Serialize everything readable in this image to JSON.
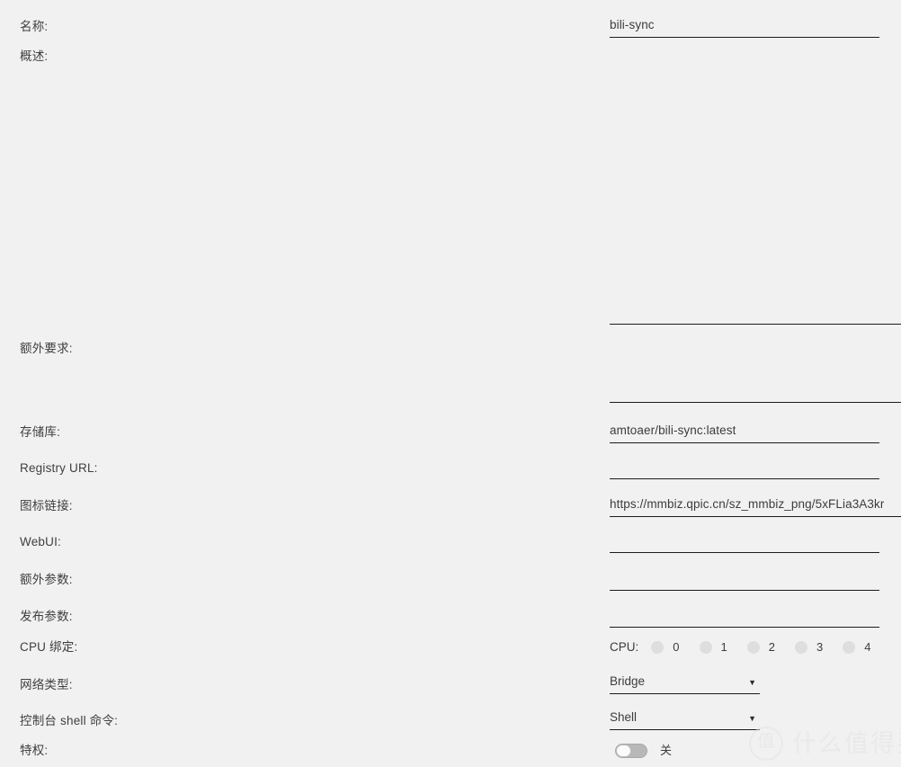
{
  "theme": {
    "background": "#f1f1f1",
    "text": "#3c3c3c",
    "underline": "#1c1c1c",
    "checkbox": "#dedede",
    "switch_track": "#b8b8b8",
    "watermark": "#e3e3e3"
  },
  "fields": {
    "name": {
      "label": "名称:",
      "value": "bili-sync",
      "placeholder": ""
    },
    "description": {
      "label": "概述:",
      "value": "",
      "placeholder": ""
    },
    "extra_requirements": {
      "label": "额外要求:",
      "value": "",
      "placeholder": ""
    },
    "repository": {
      "label": "存储库:",
      "value": "amtoaer/bili-sync:latest",
      "placeholder": ""
    },
    "registry_url": {
      "label": "Registry URL:",
      "value": "",
      "placeholder": ""
    },
    "icon_link": {
      "label": "图标链接:",
      "value": "https://mmbiz.qpic.cn/sz_mmbiz_png/5xFLia3A3kr",
      "placeholder": ""
    },
    "webui": {
      "label": "WebUI:",
      "value": "",
      "placeholder": ""
    },
    "extra_params": {
      "label": "额外参数:",
      "value": "",
      "placeholder": ""
    },
    "publish_params": {
      "label": "发布参数:",
      "value": "",
      "placeholder": ""
    },
    "cpu_binding": {
      "label": "CPU 绑定:",
      "caption": "CPU:",
      "cores": [
        {
          "num": "0",
          "checked": false
        },
        {
          "num": "1",
          "checked": false
        },
        {
          "num": "2",
          "checked": false
        },
        {
          "num": "3",
          "checked": false
        },
        {
          "num": "4",
          "checked": false
        }
      ]
    },
    "network_type": {
      "label": "网络类型:",
      "value": "Bridge",
      "caret": "▼"
    },
    "console_shell": {
      "label": "控制台 shell 命令:",
      "value": "Shell",
      "caret": "▼"
    },
    "privileged": {
      "label": "特权:",
      "state_label": "关",
      "enabled": false
    }
  },
  "watermark": {
    "badge": "值",
    "text": "什么值得买"
  }
}
